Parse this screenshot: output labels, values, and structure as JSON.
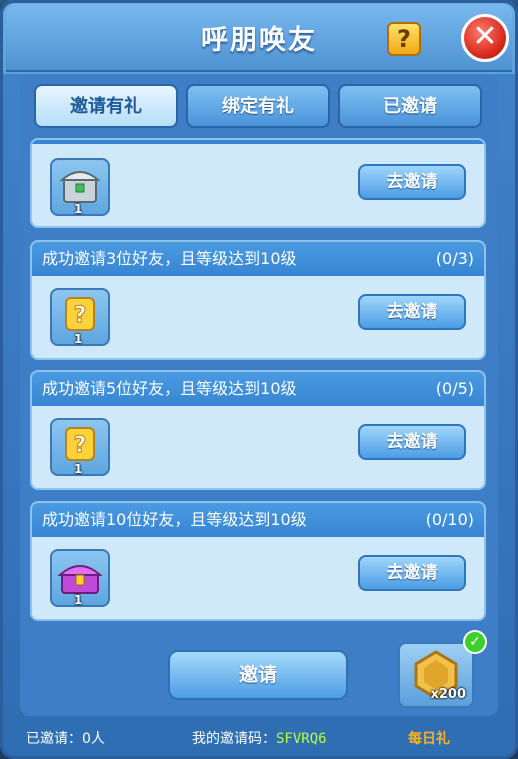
{
  "dialog": {
    "title": "呼朋唤友",
    "help_symbol": "?",
    "close_symbol": "✕"
  },
  "tabs": [
    {
      "label": "邀请有礼",
      "active": true
    },
    {
      "label": "绑定有礼",
      "active": false
    },
    {
      "label": "已邀请",
      "active": false
    }
  ],
  "tasks": [
    {
      "description": "",
      "progress": "",
      "reward_icon": "silver-chest-icon",
      "reward_count": "1",
      "button_label": "去邀请"
    },
    {
      "description": "成功邀请3位好友，且等级达到10级",
      "progress": "(0/3)",
      "reward_icon": "mystery-box-icon",
      "reward_count": "1",
      "button_label": "去邀请"
    },
    {
      "description": "成功邀请5位好友，且等级达到10级",
      "progress": "(0/5)",
      "reward_icon": "mystery-box-icon",
      "reward_count": "1",
      "button_label": "去邀请"
    },
    {
      "description": "成功邀请10位好友，且等级达到10级",
      "progress": "(0/10)",
      "reward_icon": "royal-chest-icon",
      "reward_count": "1",
      "button_label": "去邀请"
    }
  ],
  "invite_button": "邀请",
  "daily_reward": {
    "count": "x200",
    "label": "每日礼",
    "claimed": true,
    "icon": "gold-coin-icon"
  },
  "footer": {
    "invited_label": "已邀请：0人",
    "code_label": "我的邀请码：",
    "code_value": "SFVRQ6"
  },
  "colors": {
    "panel": "#3f82c8",
    "card": "#cfe9fa",
    "card_header": "#3785d2",
    "code": "#b9ff3b",
    "daily": "#ffb020",
    "close": "#d7281c"
  }
}
